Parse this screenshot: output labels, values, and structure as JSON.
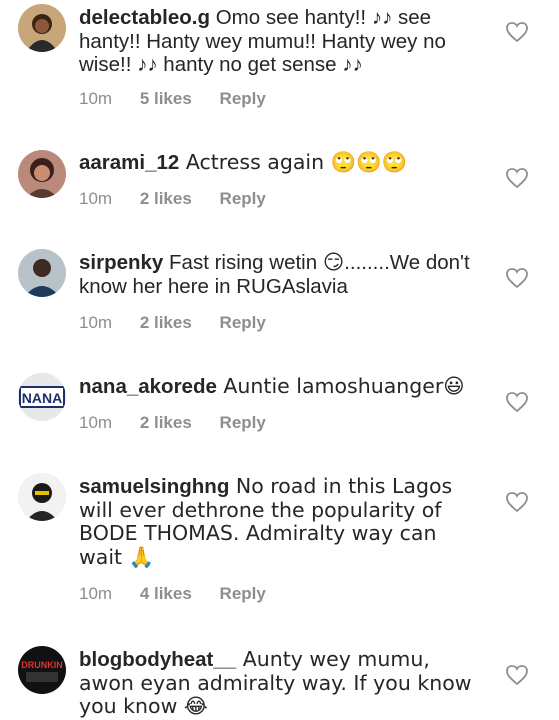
{
  "comments": [
    {
      "username": "delectableo.g",
      "text": " Omo see hanty!! ♪♪ see hanty!! Hanty wey mumu!! Hanty wey no wise!! ♪♪ hanty no get sense ♪♪",
      "time": "10m",
      "likes": "5 likes",
      "reply": "Reply"
    },
    {
      "username": "aarami_12",
      "text": " Actress again 🙄🙄🙄",
      "time": "10m",
      "likes": "2 likes",
      "reply": "Reply"
    },
    {
      "username": "sirpenky",
      "text": " Fast rising wetin 😏........We don't know her here in RUGAslavia",
      "time": "10m",
      "likes": "2 likes",
      "reply": "Reply"
    },
    {
      "username": "nana_akorede",
      "text": " Auntie lamoshuanger😃",
      "time": "10m",
      "likes": "2 likes",
      "reply": "Reply"
    },
    {
      "username": "samuelsinghng",
      "text": " No road in this Lagos will ever dethrone the popularity of BODE THOMAS. Admiralty way can wait 🙏",
      "time": "10m",
      "likes": "4 likes",
      "reply": "Reply"
    },
    {
      "username": "blogbodyheat__",
      "text": " Aunty wey mumu, awon eyan admiralty way. If you know you know 😂",
      "time": "",
      "likes": "",
      "reply": ""
    }
  ],
  "avatars": {
    "nana_akorede": "NANA",
    "blogbodyheat__": "DRUNKIN"
  },
  "colors": {
    "text": "#262626",
    "meta": "#8e8e8e",
    "heart_stroke": "#8e8e8e"
  }
}
